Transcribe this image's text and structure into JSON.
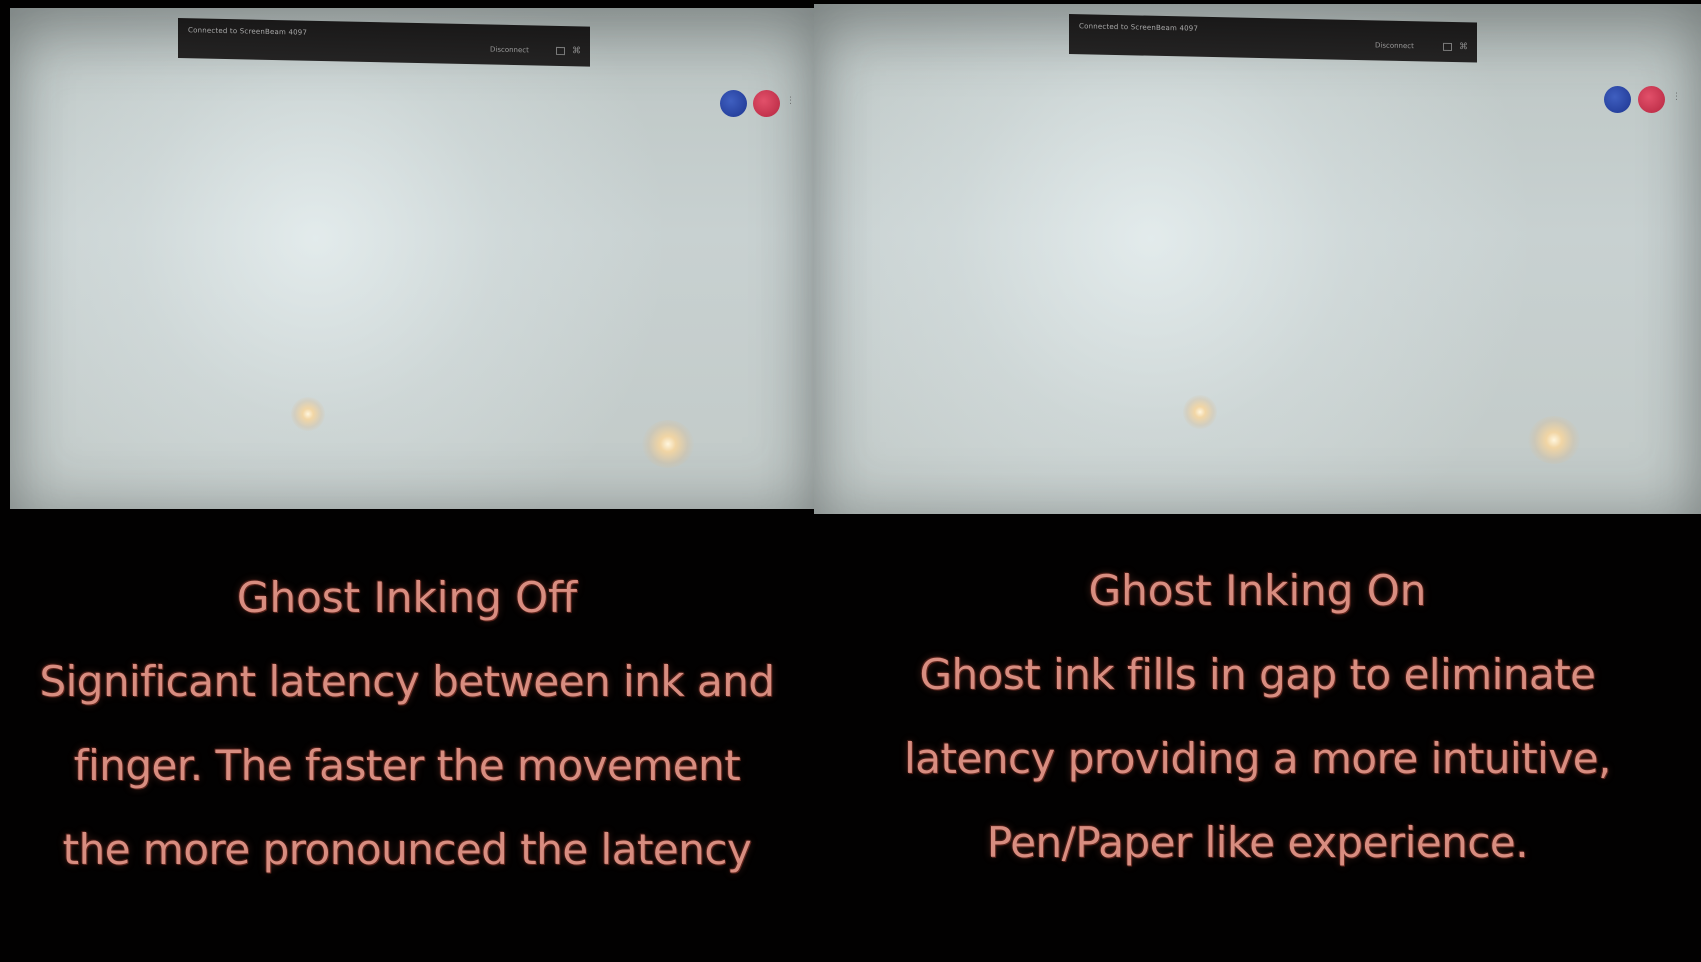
{
  "panels": [
    {
      "status_text": "Connected to ScreenBeam 4097",
      "disconnect_label": "Disconnect",
      "title": "Ghost Inking Off",
      "lines": [
        "Significant latency between ink and",
        "finger. The faster the movement",
        "the more pronounced the latency"
      ]
    },
    {
      "status_text": "Connected to ScreenBeam 4097",
      "disconnect_label": "Disconnect",
      "title": "Ghost Inking On",
      "lines": [
        "Ghost ink fills in gap to eliminate",
        "latency providing a more intuitive,",
        "Pen/Paper like experience."
      ]
    }
  ],
  "colors": {
    "caption": "#d88d80",
    "background": "#020101",
    "screen": "#c6cfcf",
    "blue_button": "#2a45a8",
    "red_button": "#cc3a55"
  },
  "icons": [
    "minimize-icon",
    "pin-icon"
  ]
}
